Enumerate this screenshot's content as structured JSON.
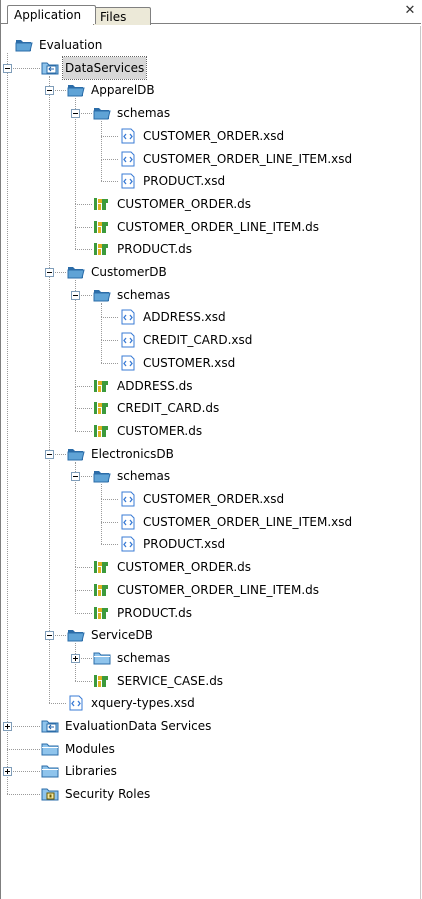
{
  "tabs": [
    {
      "label": "Application",
      "active": true
    },
    {
      "label": "Files",
      "active": false
    }
  ],
  "close_icon": "close-icon",
  "colors": {
    "folder_fill": "#5fa3d6",
    "folder_dark": "#2b6ca8",
    "xsd_blue": "#3a7bd5",
    "ds_green": "#3c9a3c",
    "ds_yellow": "#e0b020"
  },
  "tree": [
    {
      "label": "Evaluation",
      "icon": "project-folder-icon",
      "depth": 0,
      "expander": null
    },
    {
      "label": "DataServices",
      "icon": "dataservices-icon",
      "depth": 1,
      "expander": "minus",
      "selected": true
    },
    {
      "label": "ApparelDB",
      "icon": "folder-open-icon",
      "depth": 2,
      "expander": "minus"
    },
    {
      "label": "schemas",
      "icon": "folder-open-icon",
      "depth": 3,
      "expander": "minus"
    },
    {
      "label": "CUSTOMER_ORDER.xsd",
      "icon": "xsd-file-icon",
      "depth": 4,
      "expander": null
    },
    {
      "label": "CUSTOMER_ORDER_LINE_ITEM.xsd",
      "icon": "xsd-file-icon",
      "depth": 4,
      "expander": null
    },
    {
      "label": "PRODUCT.xsd",
      "icon": "xsd-file-icon",
      "depth": 4,
      "expander": null
    },
    {
      "label": "CUSTOMER_ORDER.ds",
      "icon": "ds-file-icon",
      "depth": 3,
      "expander": null
    },
    {
      "label": "CUSTOMER_ORDER_LINE_ITEM.ds",
      "icon": "ds-file-icon",
      "depth": 3,
      "expander": null
    },
    {
      "label": "PRODUCT.ds",
      "icon": "ds-file-icon",
      "depth": 3,
      "expander": null
    },
    {
      "label": "CustomerDB",
      "icon": "folder-open-icon",
      "depth": 2,
      "expander": "minus"
    },
    {
      "label": "schemas",
      "icon": "folder-open-icon",
      "depth": 3,
      "expander": "minus"
    },
    {
      "label": "ADDRESS.xsd",
      "icon": "xsd-file-icon",
      "depth": 4,
      "expander": null
    },
    {
      "label": "CREDIT_CARD.xsd",
      "icon": "xsd-file-icon",
      "depth": 4,
      "expander": null
    },
    {
      "label": "CUSTOMER.xsd",
      "icon": "xsd-file-icon",
      "depth": 4,
      "expander": null
    },
    {
      "label": "ADDRESS.ds",
      "icon": "ds-file-icon",
      "depth": 3,
      "expander": null
    },
    {
      "label": "CREDIT_CARD.ds",
      "icon": "ds-file-icon",
      "depth": 3,
      "expander": null
    },
    {
      "label": "CUSTOMER.ds",
      "icon": "ds-file-icon",
      "depth": 3,
      "expander": null
    },
    {
      "label": "ElectronicsDB",
      "icon": "folder-open-icon",
      "depth": 2,
      "expander": "minus"
    },
    {
      "label": "schemas",
      "icon": "folder-open-icon",
      "depth": 3,
      "expander": "minus"
    },
    {
      "label": "CUSTOMER_ORDER.xsd",
      "icon": "xsd-file-icon",
      "depth": 4,
      "expander": null
    },
    {
      "label": "CUSTOMER_ORDER_LINE_ITEM.xsd",
      "icon": "xsd-file-icon",
      "depth": 4,
      "expander": null
    },
    {
      "label": "PRODUCT.xsd",
      "icon": "xsd-file-icon",
      "depth": 4,
      "expander": null
    },
    {
      "label": "CUSTOMER_ORDER.ds",
      "icon": "ds-file-icon",
      "depth": 3,
      "expander": null
    },
    {
      "label": "CUSTOMER_ORDER_LINE_ITEM.ds",
      "icon": "ds-file-icon",
      "depth": 3,
      "expander": null
    },
    {
      "label": "PRODUCT.ds",
      "icon": "ds-file-icon",
      "depth": 3,
      "expander": null
    },
    {
      "label": "ServiceDB",
      "icon": "folder-open-icon",
      "depth": 2,
      "expander": "minus"
    },
    {
      "label": "schemas",
      "icon": "folder-closed-icon",
      "depth": 3,
      "expander": "plus"
    },
    {
      "label": "SERVICE_CASE.ds",
      "icon": "ds-file-icon",
      "depth": 3,
      "expander": null
    },
    {
      "label": "xquery-types.xsd",
      "icon": "xsd-file-icon",
      "depth": 2,
      "expander": null
    },
    {
      "label": "EvaluationData Services",
      "icon": "dataservices-icon",
      "depth": 1,
      "expander": "plus"
    },
    {
      "label": "Modules",
      "icon": "folder-closed-icon",
      "depth": 1,
      "expander": null
    },
    {
      "label": "Libraries",
      "icon": "folder-closed-icon",
      "depth": 1,
      "expander": "plus"
    },
    {
      "label": "Security Roles",
      "icon": "security-roles-icon",
      "depth": 1,
      "expander": null
    }
  ]
}
